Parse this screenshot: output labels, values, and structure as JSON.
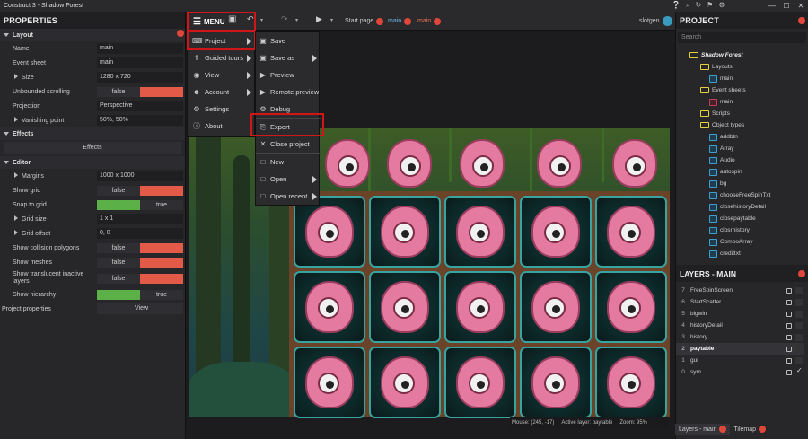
{
  "window": {
    "title": "Construct 3 - Shadow Forest",
    "controls": [
      "—",
      "☐",
      "✕"
    ]
  },
  "top_icons": [
    "❔",
    "⌕",
    "↻",
    "⚑",
    "⚙"
  ],
  "left_panel": {
    "title": "PROPERTIES",
    "sections": {
      "layout": "Layout",
      "effects": "Effects",
      "editor": "Editor"
    },
    "layout_rows": [
      {
        "label": "Name",
        "value": "main"
      },
      {
        "label": "Event sheet",
        "value": "main"
      },
      {
        "label": "Size",
        "value": "1280 x 720"
      }
    ],
    "unbounded": {
      "label": "Unbounded scrolling",
      "value": "false"
    },
    "projection": {
      "label": "Projection",
      "value": "Perspective"
    },
    "vanishing": {
      "label": "Vanishing point",
      "value": "50%, 50%"
    },
    "effects_btn": "Effects",
    "margins": {
      "label": "Margins",
      "value": "1000 x 1000"
    },
    "show_grid": {
      "label": "Show grid",
      "value": "false"
    },
    "snap_grid": {
      "label": "Snap to grid",
      "value": "true"
    },
    "grid_size": {
      "label": "Grid size",
      "value": "1 x 1"
    },
    "grid_offset": {
      "label": "Grid offset",
      "value": "0, 0"
    },
    "show_collision": {
      "label": "Show collision polygons",
      "value": "false"
    },
    "show_meshes": {
      "label": "Show meshes",
      "value": "false"
    },
    "show_translucent": {
      "label": "Show translucent inactive layers",
      "value": "false"
    },
    "show_hierarchy": {
      "label": "Show hierarchy",
      "value": "true"
    },
    "project_props": {
      "label": "Project properties",
      "value": "View"
    }
  },
  "toolbar": {
    "menu_label": "MENU",
    "start_page": "Start page",
    "tab_main1": "main",
    "tab_main2": "main",
    "user": "slotgen"
  },
  "menu": {
    "items": [
      {
        "icon": "⌨",
        "label": "Project"
      },
      {
        "icon": "✝",
        "label": "Guided tours"
      },
      {
        "icon": "◉",
        "label": "View"
      },
      {
        "icon": "☻",
        "label": "Account"
      },
      {
        "icon": "⚙",
        "label": "Settings"
      },
      {
        "icon": "ⓘ",
        "label": "About"
      }
    ]
  },
  "submenu": {
    "items": [
      {
        "icon": "▣",
        "label": "Save"
      },
      {
        "icon": "▣",
        "label": "Save as"
      },
      {
        "icon": "▶",
        "label": "Preview"
      },
      {
        "icon": "▶",
        "label": "Remote preview"
      },
      {
        "icon": "⚙",
        "label": "Debug"
      },
      {
        "icon": "⎘",
        "label": "Export"
      },
      {
        "icon": "✕",
        "label": "Close project"
      },
      {
        "icon": "□",
        "label": "New"
      },
      {
        "icon": "□",
        "label": "Open"
      },
      {
        "icon": "□",
        "label": "Open recent"
      }
    ]
  },
  "status": {
    "mouse": "Mouse: (245, -17)",
    "active_layer": "Active layer: paytable",
    "zoom": "Zoom: 95%"
  },
  "right_panel": {
    "title": "PROJECT",
    "search_placeholder": "Search",
    "tree": {
      "root": "Shadow Forest",
      "layouts": "Layouts",
      "layout_main": "main",
      "event_sheets": "Event sheets",
      "sheet_main": "main",
      "scripts": "Scripts",
      "object_types": "Object types",
      "objects": [
        "addbtn",
        "Array",
        "Audio",
        "autospin",
        "bg",
        "chooseFreeSpinTxt",
        "closehistoryDetail",
        "closepaytable",
        "closrhistory",
        "ComboArray",
        "credittxt"
      ]
    },
    "layers_title": "LAYERS - MAIN",
    "layers": [
      {
        "n": "7",
        "name": "FreeSpinScreen"
      },
      {
        "n": "6",
        "name": "StartScatter"
      },
      {
        "n": "5",
        "name": "bigwin"
      },
      {
        "n": "4",
        "name": "historyDetail"
      },
      {
        "n": "3",
        "name": "history"
      },
      {
        "n": "2",
        "name": "paytable"
      },
      {
        "n": "1",
        "name": "gui"
      },
      {
        "n": "0",
        "name": "sym"
      }
    ],
    "bottom_tabs": [
      "Layers - main",
      "Tilemap"
    ]
  }
}
